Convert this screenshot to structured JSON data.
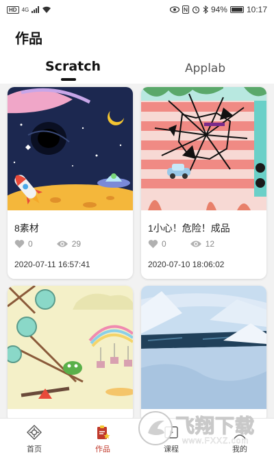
{
  "status_bar": {
    "battery_text": "94%",
    "time": "10:17",
    "network_label": "HD",
    "signal_label": "4G"
  },
  "header": {
    "title": "作品"
  },
  "tabs": [
    {
      "label": "Scratch",
      "active": true
    },
    {
      "label": "Applab",
      "active": false
    }
  ],
  "works": [
    {
      "title": "8素材",
      "likes": "0",
      "views": "29",
      "date": "2020-07-11 16:57:41"
    },
    {
      "title": "1小心！危险！成品",
      "likes": "0",
      "views": "12",
      "date": "2020-07-10 18:06:02"
    },
    {
      "title": "",
      "likes": "",
      "views": "",
      "date": ""
    },
    {
      "title": "",
      "likes": "",
      "views": "",
      "date": ""
    }
  ],
  "bottom_nav": [
    {
      "label": "首页",
      "icon": "home-icon",
      "active": false
    },
    {
      "label": "作品",
      "icon": "works-icon",
      "active": true
    },
    {
      "label": "课程",
      "icon": "course-icon",
      "active": false
    },
    {
      "label": "我的",
      "icon": "profile-icon",
      "active": false
    }
  ],
  "watermark": {
    "brand": "飞翔下载",
    "url": "www.FXXZ.com"
  },
  "colors": {
    "accent": "#c0392b",
    "background": "#f2f2f2",
    "card": "#ffffff",
    "muted_text": "#888888"
  }
}
